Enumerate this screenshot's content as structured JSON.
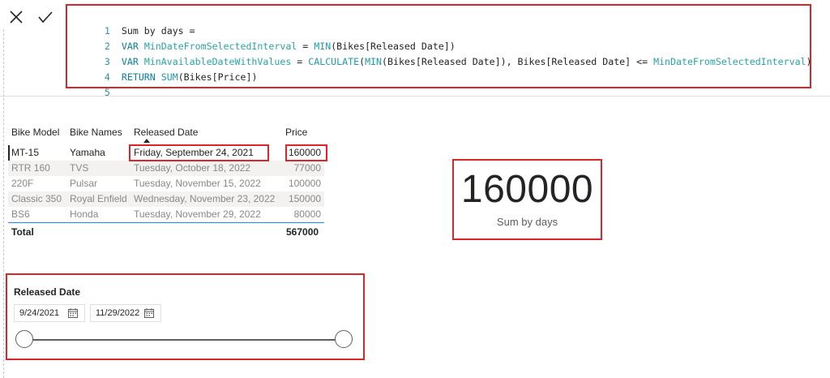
{
  "formula_bar": {
    "lines": [
      {
        "num": "1",
        "text": " Sum by days ="
      },
      {
        "num": "2",
        "text": " VAR MinDateFromSelectedInterval = MIN(Bikes[Released Date])"
      },
      {
        "num": "3",
        "text": " VAR MinAvailableDateWithValues = CALCULATE(MIN(Bikes[Released Date]), Bikes[Released Date] <= MinDateFromSelectedInterval)"
      },
      {
        "num": "4",
        "text": " RETURN SUM(Bikes[Price])"
      },
      {
        "num": "5",
        "text": ""
      }
    ]
  },
  "table": {
    "headers": {
      "model": "Bike Model",
      "name": "Bike Names",
      "date": "Released Date",
      "price": "Price"
    },
    "rows": [
      {
        "model": "MT-15",
        "name": "Yamaha",
        "date": "Friday, September 24, 2021",
        "price": "160000"
      },
      {
        "model": "RTR 160",
        "name": "TVS",
        "date": "Tuesday, October 18, 2022",
        "price": "77000"
      },
      {
        "model": "220F",
        "name": "Pulsar",
        "date": "Tuesday, November 15, 2022",
        "price": "100000"
      },
      {
        "model": "Classic 350",
        "name": "Royal Enfield",
        "date": "Wednesday, November 23, 2022",
        "price": "150000"
      },
      {
        "model": "BS6",
        "name": "Honda",
        "date": "Tuesday, November 29, 2022",
        "price": "80000"
      }
    ],
    "total_label": "Total",
    "total_value": "567000"
  },
  "card": {
    "value": "160000",
    "label": "Sum by days"
  },
  "slicer": {
    "title": "Released Date",
    "start_date": "9/24/2021",
    "end_date": "11/29/2022",
    "range": [
      0,
      1
    ]
  },
  "colors": {
    "highlight": "#d9262a",
    "accent_rule": "#118dff",
    "keyword": "#0b7f9c"
  }
}
